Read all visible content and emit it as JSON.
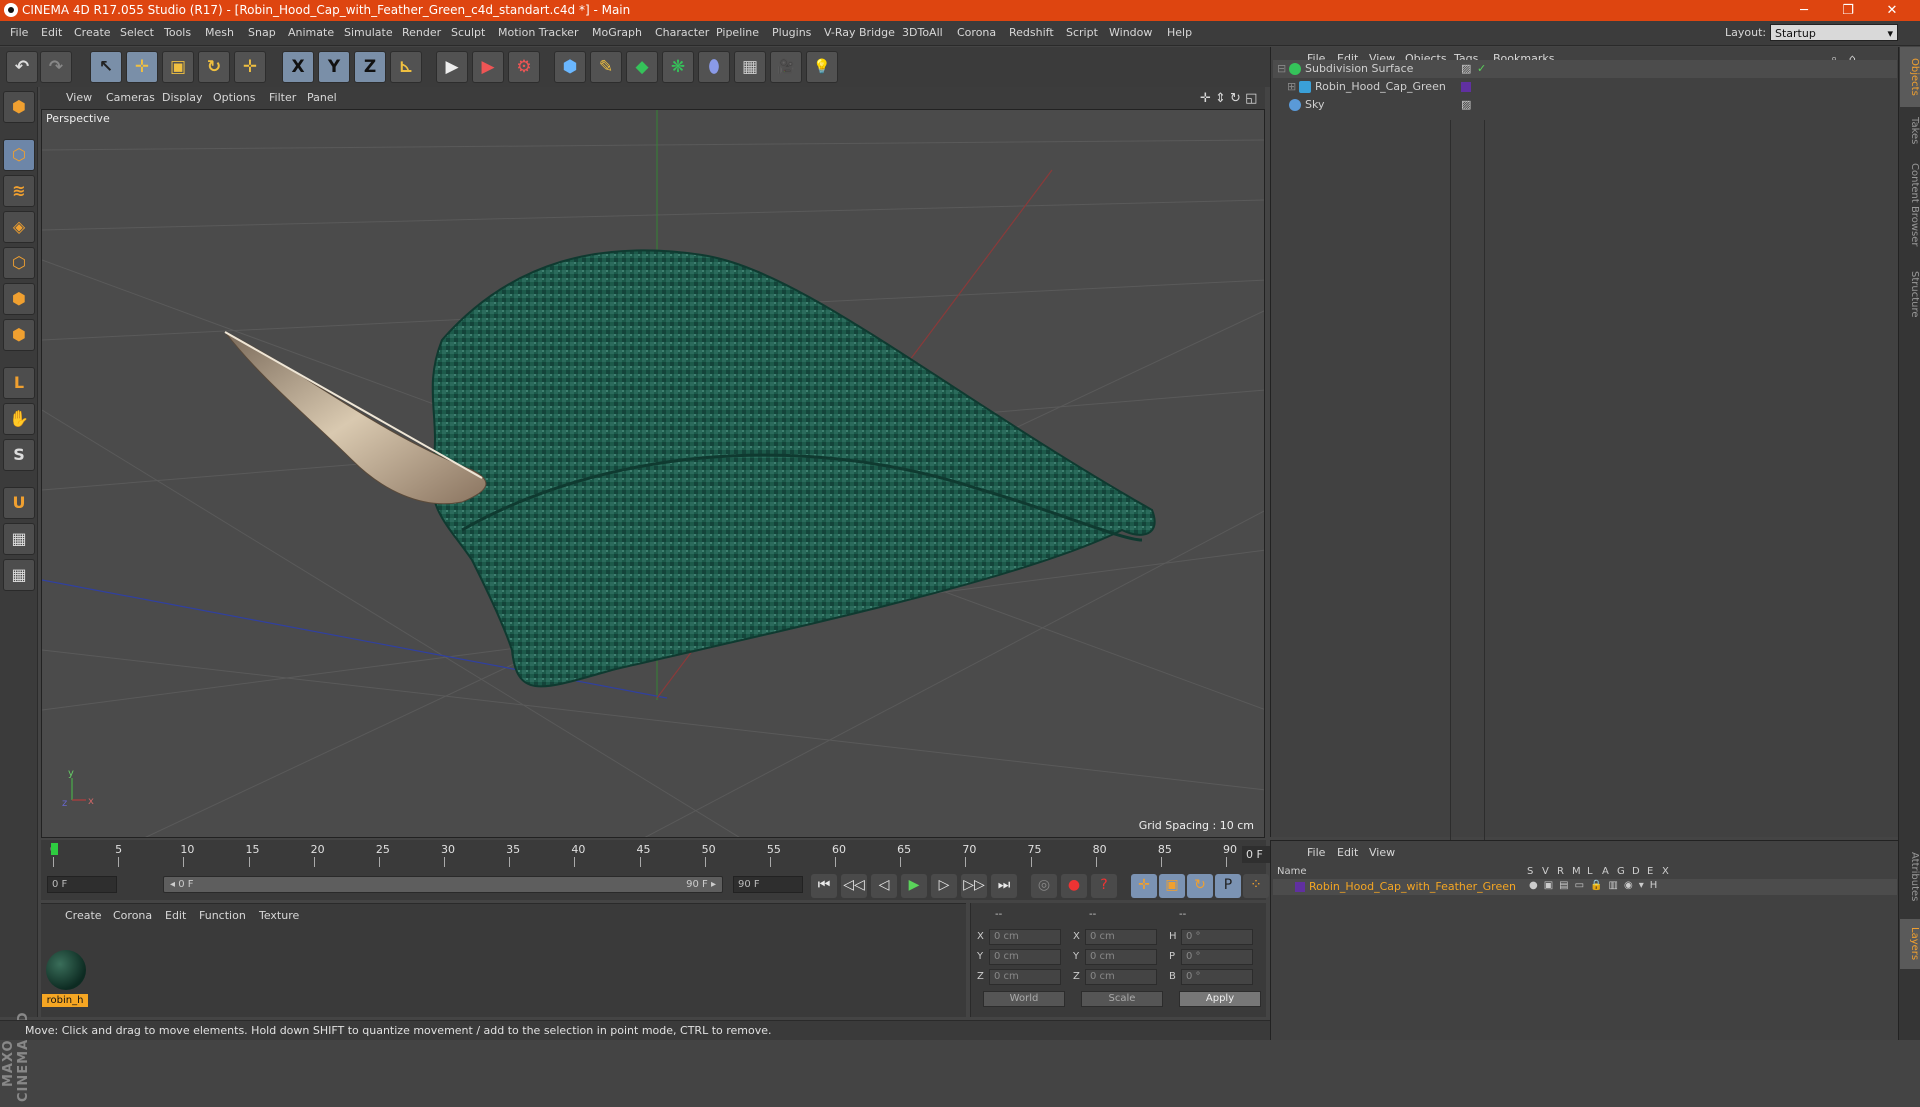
{
  "window": {
    "title": "CINEMA 4D R17.055 Studio (R17) - [Robin_Hood_Cap_with_Feather_Green_c4d_standart.c4d *] - Main",
    "min": "─",
    "max": "❐",
    "close": "✕"
  },
  "menu": [
    "File",
    "Edit",
    "Create",
    "Select",
    "Tools",
    "Mesh",
    "Snap",
    "Animate",
    "Simulate",
    "Render",
    "Sculpt",
    "Motion Tracker",
    "MoGraph",
    "Character",
    "Pipeline",
    "Plugins",
    "V-Ray Bridge",
    "3DToAll",
    "Corona",
    "Redshift",
    "Script",
    "Window",
    "Help"
  ],
  "layout": {
    "label": "Layout:",
    "value": "Startup"
  },
  "toolbar": {
    "undo": "↶",
    "redo": "↷",
    "select": "↖",
    "move": "✛",
    "scale": "▣",
    "rotate": "↻",
    "move2": "✛",
    "x": "X",
    "y": "Y",
    "z": "Z",
    "coord": "⊾",
    "render_view": "▶",
    "render_pv": "▶",
    "render_settings": "⚙",
    "cube": "⬢",
    "pen": "✎",
    "subdiv": "◆",
    "cloner": "❋",
    "deformer": "⬮",
    "floor": "▦",
    "camera": "🎥",
    "light": "💡"
  },
  "left_tools": [
    "⬢",
    "⬡",
    "≋",
    "◈",
    "⬡",
    "⬢",
    "L",
    "✋",
    "S",
    "U",
    "▦",
    "▦"
  ],
  "viewport": {
    "menu": [
      "View",
      "Cameras",
      "Display",
      "Options",
      "Filter",
      "Panel"
    ],
    "label": "Perspective",
    "grid_spacing": "Grid Spacing : 10 cm",
    "axis_y": "y",
    "axis_x": "x",
    "axis_z": "z"
  },
  "timeline": {
    "ticks": [
      "0",
      "5",
      "10",
      "15",
      "20",
      "25",
      "30",
      "35",
      "40",
      "45",
      "50",
      "55",
      "60",
      "65",
      "70",
      "75",
      "80",
      "85",
      "90"
    ],
    "frame": "0 F"
  },
  "transport": {
    "start": "0 F",
    "slider_left": "◂ 0 F",
    "slider_right": "90 F ▸",
    "end": "90 F",
    "buttons": [
      "⏮",
      "◁◁",
      "◁",
      "▶",
      "▷",
      "▷▷",
      "⏭"
    ],
    "extra": [
      "◎",
      "●",
      "?",
      "✛",
      "▣",
      "↻",
      "P",
      "⁘",
      "▦"
    ]
  },
  "materials": {
    "menu": [
      "Create",
      "Corona",
      "Edit",
      "Function",
      "Texture"
    ],
    "item": "robin_h"
  },
  "coords": {
    "headers": [
      "--",
      "--",
      "--"
    ],
    "rows": [
      {
        "a": "X",
        "av": "0 cm",
        "b": "X",
        "bv": "0 cm",
        "c": "H",
        "cv": "0 °"
      },
      {
        "a": "Y",
        "av": "0 cm",
        "b": "Y",
        "bv": "0 cm",
        "c": "P",
        "cv": "0 °"
      },
      {
        "a": "Z",
        "av": "0 cm",
        "b": "Z",
        "bv": "0 cm",
        "c": "B",
        "cv": "0 °"
      }
    ],
    "world": "World",
    "scale": "Scale",
    "apply": "Apply"
  },
  "status": "Move: Click and drag to move elements. Hold down SHIFT to quantize movement / add to the selection in point mode, CTRL to remove.",
  "objects": {
    "menu": [
      "File",
      "Edit",
      "View",
      "Objects",
      "Tags",
      "Bookmarks"
    ],
    "items": [
      {
        "name": "Subdivision Surface",
        "color": "#35c35a"
      },
      {
        "name": "Robin_Hood_Cap_Green",
        "color": "#3aa0d8"
      },
      {
        "name": "Sky",
        "color": "#5a9ad8"
      }
    ]
  },
  "layers": {
    "menu": [
      "File",
      "Edit",
      "View"
    ],
    "name_header": "Name",
    "cols": [
      "S",
      "V",
      "R",
      "M",
      "L",
      "A",
      "G",
      "D",
      "E",
      "X"
    ],
    "item": "Robin_Hood_Cap_with_Feather_Green"
  },
  "side_tabs": [
    "Objects",
    "Takes",
    "Content Browser",
    "Structure",
    "Attributes",
    "Layers"
  ]
}
